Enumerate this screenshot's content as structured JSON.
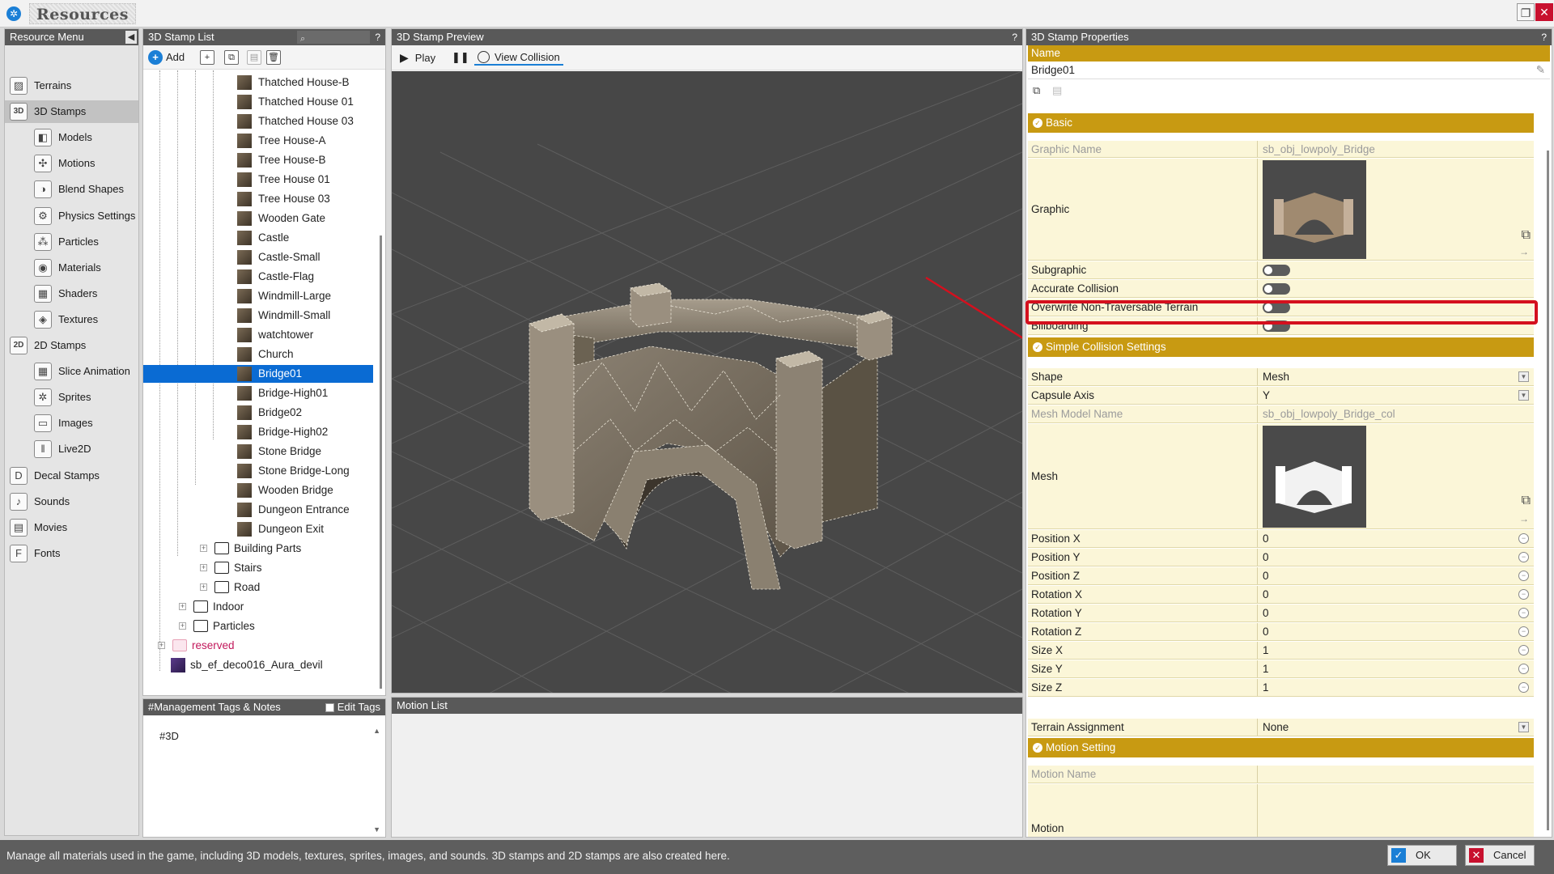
{
  "window": {
    "title": "Resources"
  },
  "resource_menu": {
    "header": "Resource Menu",
    "items": [
      {
        "label": "Terrains",
        "icon": "terrain-icon"
      },
      {
        "label": "3D Stamps",
        "icon": "3d-stamp-icon",
        "selected": true
      },
      {
        "label": "Models",
        "icon": "model-icon"
      },
      {
        "label": "Motions",
        "icon": "motion-icon"
      },
      {
        "label": "Blend Shapes",
        "icon": "blend-shape-icon"
      },
      {
        "label": "Physics Settings",
        "icon": "physics-icon"
      },
      {
        "label": "Particles",
        "icon": "particle-icon"
      },
      {
        "label": "Materials",
        "icon": "material-icon"
      },
      {
        "label": "Shaders",
        "icon": "shader-icon"
      },
      {
        "label": "Textures",
        "icon": "texture-icon"
      },
      {
        "label": "2D Stamps",
        "icon": "2d-stamp-icon"
      },
      {
        "label": "Slice Animation",
        "icon": "slice-animation-icon"
      },
      {
        "label": "Sprites",
        "icon": "sprite-icon"
      },
      {
        "label": "Images",
        "icon": "image-icon"
      },
      {
        "label": "Live2D",
        "icon": "live2d-icon"
      },
      {
        "label": "Decal Stamps",
        "icon": "decal-icon"
      },
      {
        "label": "Sounds",
        "icon": "sound-icon"
      },
      {
        "label": "Movies",
        "icon": "movie-icon"
      },
      {
        "label": "Fonts",
        "icon": "font-icon"
      }
    ]
  },
  "stamp_list": {
    "header": "3D Stamp List",
    "add_label": "Add",
    "items": [
      "Thatched House-B",
      "Thatched House 01",
      "Thatched House 03",
      "Tree House-A",
      "Tree House-B",
      "Tree House 01",
      "Tree House 03",
      "Wooden Gate",
      "Castle",
      "Castle-Small",
      "Castle-Flag",
      "Windmill-Large",
      "Windmill-Small",
      "watchtower",
      "Church",
      "Bridge01",
      "Bridge-High01",
      "Bridge02",
      "Bridge-High02",
      "Stone Bridge",
      "Stone Bridge-Long",
      "Wooden Bridge",
      "Dungeon Entrance",
      "Dungeon Exit"
    ],
    "selected": "Bridge01",
    "folders": [
      {
        "label": "Building Parts"
      },
      {
        "label": "Stairs"
      },
      {
        "label": "Road"
      },
      {
        "label": "Indoor"
      },
      {
        "label": "Particles"
      },
      {
        "label": "reserved"
      }
    ],
    "extra_item": "sb_ef_deco016_Aura_devil"
  },
  "tags": {
    "header": "#Management Tags & Notes",
    "edit_label": "Edit Tags",
    "text": "#3D"
  },
  "preview": {
    "header": "3D Stamp Preview",
    "play_label": "Play",
    "view_collision_label": "View Collision"
  },
  "motion_list": {
    "header": "Motion List"
  },
  "properties": {
    "header": "3D Stamp Properties",
    "name_label": "Name",
    "name_value": "Bridge01",
    "sections": {
      "basic": "Basic",
      "simple_collision": "Simple Collision Settings",
      "motion": "Motion Setting"
    },
    "graphic_name_label": "Graphic Name",
    "graphic_name_value": "sb_obj_lowpoly_Bridge",
    "graphic_label": "Graphic",
    "subgraphic_label": "Subgraphic",
    "accurate_collision_label": "Accurate Collision",
    "overwrite_label": "Overwrite Non-Traversable Terrain",
    "billboarding_label": "Billboarding",
    "shape_label": "Shape",
    "shape_value": "Mesh",
    "capsule_axis_label": "Capsule Axis",
    "capsule_axis_value": "Y",
    "mesh_model_name_label": "Mesh Model Name",
    "mesh_model_name_value": "sb_obj_lowpoly_Bridge_col",
    "mesh_label": "Mesh",
    "numeric": [
      {
        "label": "Position X",
        "value": "0"
      },
      {
        "label": "Position Y",
        "value": "0"
      },
      {
        "label": "Position Z",
        "value": "0"
      },
      {
        "label": "Rotation X",
        "value": "0"
      },
      {
        "label": "Rotation Y",
        "value": "0"
      },
      {
        "label": "Rotation Z",
        "value": "0"
      },
      {
        "label": "Size X",
        "value": "1"
      },
      {
        "label": "Size Y",
        "value": "1"
      },
      {
        "label": "Size Z",
        "value": "1"
      }
    ],
    "terrain_assignment_label": "Terrain Assignment",
    "terrain_assignment_value": "None",
    "motion_name_label": "Motion Name",
    "motion_label": "Motion"
  },
  "status": {
    "text": "Manage all materials used in the game, including 3D models, textures, sprites, images, and sounds. 3D stamps and 2D stamps are also created here.",
    "ok_label": "OK",
    "cancel_label": "Cancel"
  },
  "colors": {
    "accent": "#1b7fd6",
    "section": "#c89a12",
    "highlight": "#d4101e",
    "selection": "#0a6bd3"
  }
}
